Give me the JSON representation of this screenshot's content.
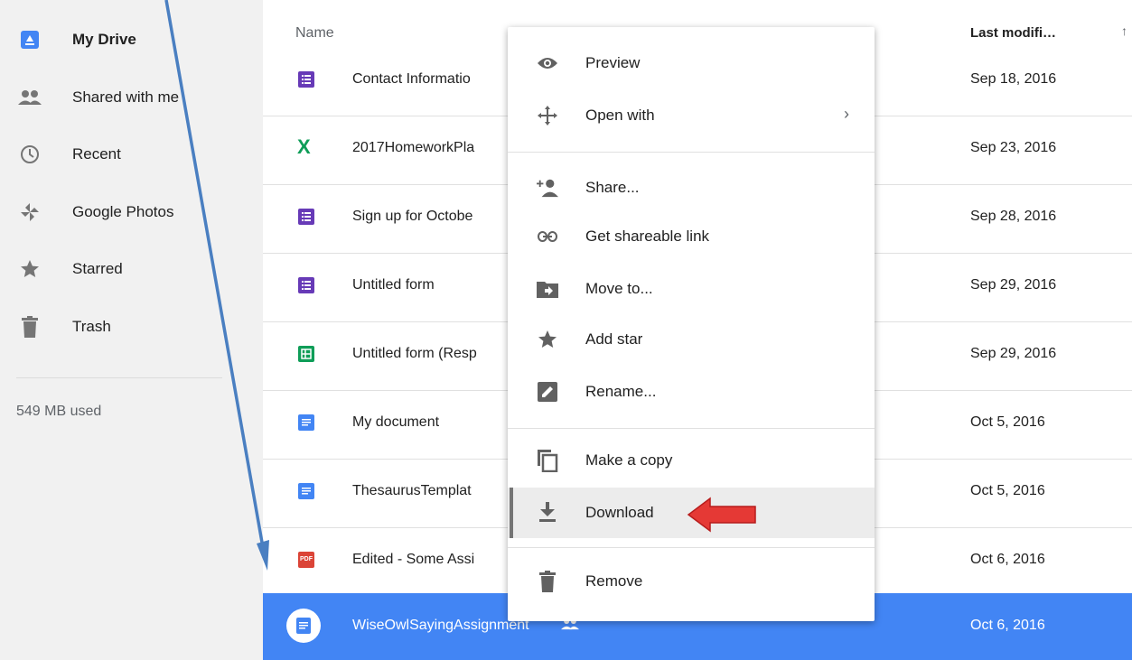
{
  "sidebar": {
    "items": [
      {
        "label": "My Drive",
        "icon": "drive-icon"
      },
      {
        "label": "Shared with me",
        "icon": "people-icon"
      },
      {
        "label": "Recent",
        "icon": "clock-icon"
      },
      {
        "label": "Google Photos",
        "icon": "pinwheel-icon"
      },
      {
        "label": "Starred",
        "icon": "star-icon"
      },
      {
        "label": "Trash",
        "icon": "trash-icon"
      }
    ],
    "storage": "549 MB used"
  },
  "table": {
    "header_name": "Name",
    "header_modified": "Last modifi…",
    "rows": [
      {
        "name": "Contact Informatio",
        "date": "Sep 18, 2016",
        "icon": "forms-icon"
      },
      {
        "name": "2017HomeworkPla",
        "date": "Sep 23, 2016",
        "icon": "excel-icon"
      },
      {
        "name": "Sign up for Octobe",
        "date": "Sep 28, 2016",
        "icon": "forms-icon"
      },
      {
        "name": "Untitled form",
        "date": "Sep 29, 2016",
        "icon": "forms-icon"
      },
      {
        "name": "Untitled form (Resp",
        "date": "Sep 29, 2016",
        "icon": "sheets-icon"
      },
      {
        "name": "My document",
        "date": "Oct 5, 2016",
        "icon": "docs-icon"
      },
      {
        "name": "ThesaurusTemplat",
        "date": "Oct 5, 2016",
        "icon": "docs-icon"
      },
      {
        "name": "Edited - Some Assi",
        "date": "Oct 6, 2016",
        "icon": "pdf-icon"
      },
      {
        "name": "WiseOwlSayingAssignment",
        "date": "Oct 6, 2016",
        "icon": "docs-icon"
      }
    ]
  },
  "menu": {
    "items": [
      {
        "label": "Preview",
        "icon": "eye-icon"
      },
      {
        "label": "Open with",
        "icon": "move-arrows-icon",
        "submenu": "›"
      },
      {
        "label": "Share...",
        "icon": "add-person-icon"
      },
      {
        "label": "Get shareable link",
        "icon": "link-icon"
      },
      {
        "label": "Move to...",
        "icon": "folder-move-icon"
      },
      {
        "label": "Add star",
        "icon": "star-icon"
      },
      {
        "label": "Rename...",
        "icon": "pencil-icon"
      },
      {
        "label": "Make a copy",
        "icon": "copy-icon"
      },
      {
        "label": "Download",
        "icon": "download-icon"
      },
      {
        "label": "Remove",
        "icon": "trash-icon"
      }
    ]
  },
  "icons": {
    "forms_badge": "☰",
    "excel_badge": "X",
    "pdf_badge": "PDF"
  },
  "colors": {
    "selected": "#4285f4",
    "forms": "#673ab7",
    "sheets": "#0f9d58",
    "docs": "#4285f4",
    "pdf": "#db4437",
    "red_arrow": "#e53935",
    "blue_arrow": "#4a7fc1"
  }
}
